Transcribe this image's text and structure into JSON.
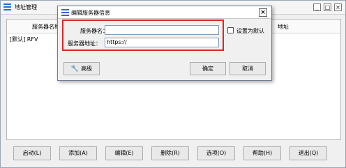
{
  "main_window": {
    "title": "地址管理",
    "controls": {
      "minimize": "_",
      "maximize": "□",
      "close": "×"
    }
  },
  "table": {
    "columns": [
      "服务器名称",
      "地址"
    ],
    "rows": [
      {
        "name": "[默认] RFV"
      }
    ]
  },
  "bottom_buttons": [
    "启动(L)",
    "添加(A)",
    "编辑(E)",
    "删除(R)",
    "选项(O)",
    "帮助(H)",
    "退出(Q)"
  ],
  "dialog": {
    "title": "编辑服务器信息",
    "close": "×",
    "server_name_label": "服务器名：",
    "server_name_value": "",
    "server_address_label": "服务器地址：",
    "server_address_value": "https://",
    "set_default_label": "设置为默认",
    "set_default_checked": false,
    "advanced_label": "高级",
    "ok_label": "确定",
    "cancel_label": "取消",
    "highlight_color": "#e0242b"
  }
}
